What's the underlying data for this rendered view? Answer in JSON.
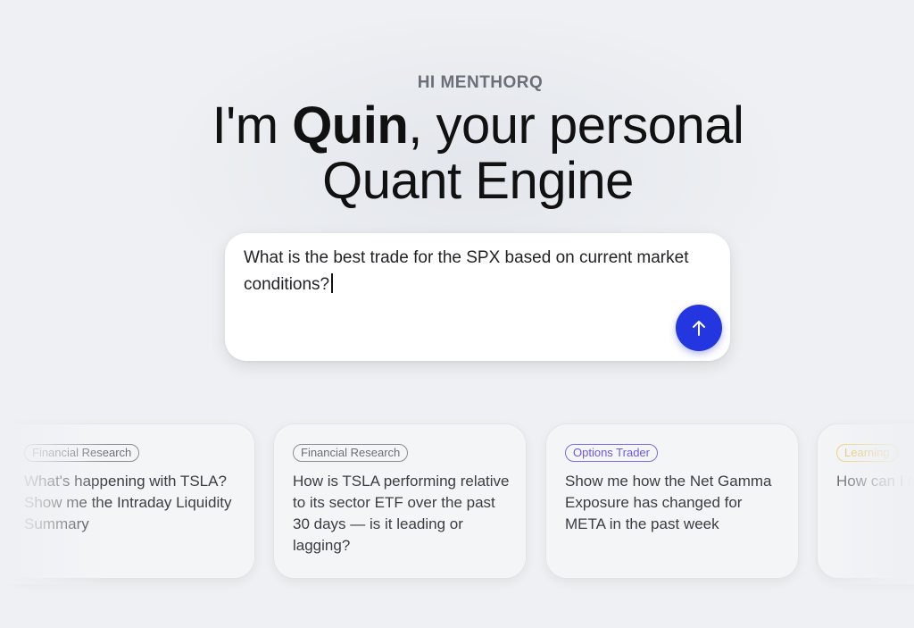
{
  "greeting": "HI MENTHORQ",
  "headline": {
    "prefix": "I'm ",
    "name": "Quin",
    "suffix_line1": ", your personal",
    "line2": "Quant Engine"
  },
  "composer": {
    "value": "What is the best trade for the SPX based on current market conditions?",
    "send_icon": "arrow-up-icon",
    "accent_color": "#2436e0"
  },
  "suggestions": [
    {
      "tag": "Financial Research",
      "text": "What's happening with TSLA? Show me the Intraday Liquidity Summary"
    },
    {
      "tag": "Financial Research",
      "text": "How is TSLA performing relative to its sector ETF over the past 30 days — is it leading or lagging?"
    },
    {
      "tag": "Options Trader",
      "text": "Show me how the Net Gamma Exposure has changed for META in the past week"
    },
    {
      "tag": "Learning",
      "text": "How can I trade Options"
    }
  ]
}
